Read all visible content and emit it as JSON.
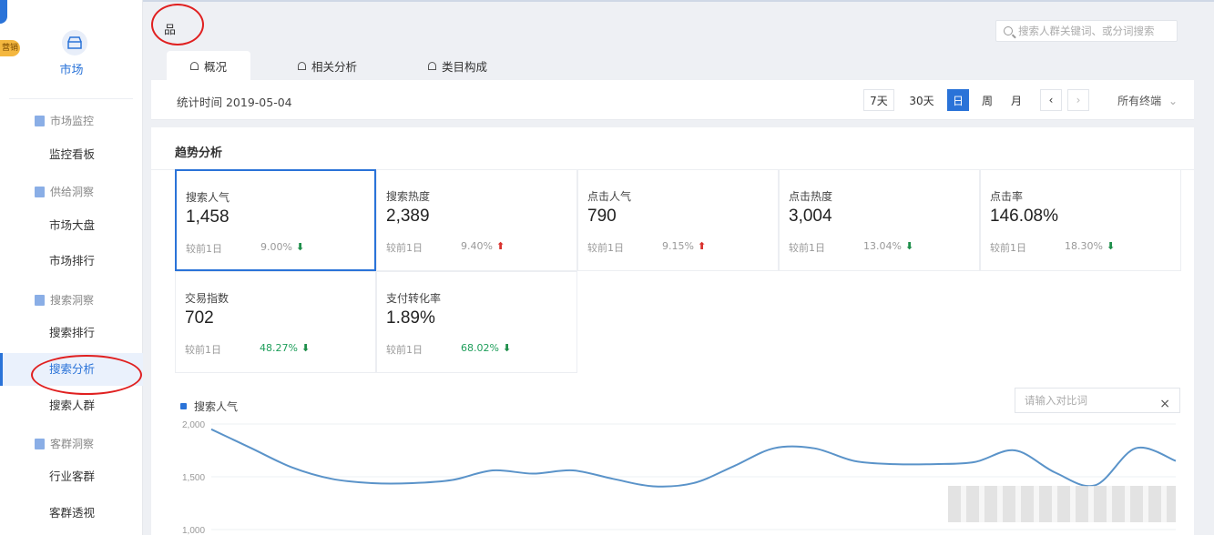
{
  "sidebar": {
    "badge": "营销",
    "market_label": "市场",
    "sections": [
      {
        "label": "市场监控",
        "items": [
          "监控看板"
        ]
      },
      {
        "label": "供给洞察",
        "items": [
          "市场大盘",
          "市场排行"
        ]
      },
      {
        "label": "搜索洞察",
        "items": [
          "搜索排行",
          "搜索分析",
          "搜索人群"
        ]
      },
      {
        "label": "客群洞察",
        "items": [
          "行业客群",
          "客群透视"
        ]
      }
    ],
    "active_item": "搜索分析"
  },
  "header": {
    "breadcrumb": "品",
    "search_placeholder": "搜索人群关键词、或分词搜索"
  },
  "tabs": [
    {
      "label": "概况",
      "active": true
    },
    {
      "label": "相关分析",
      "active": false
    },
    {
      "label": "类目构成",
      "active": false
    }
  ],
  "datebar": {
    "date_label": "统计时间 2019-05-04",
    "periods": [
      "7天",
      "30天",
      "日",
      "周",
      "月"
    ],
    "active_period": "日",
    "channel": "所有终端"
  },
  "overview": {
    "title": "趋势分析",
    "compare_label": "较前1日",
    "metrics": [
      {
        "label": "搜索人气",
        "value": "1,458",
        "pct": "9.00%",
        "dir": "down"
      },
      {
        "label": "搜索热度",
        "value": "2,389",
        "pct": "9.40%",
        "dir": "up"
      },
      {
        "label": "点击人气",
        "value": "790",
        "pct": "9.15%",
        "dir": "up"
      },
      {
        "label": "点击热度",
        "value": "3,004",
        "pct": "13.04%",
        "dir": "down"
      },
      {
        "label": "点击率",
        "value": "146.08%",
        "pct": "18.30%",
        "dir": "down"
      },
      {
        "label": "交易指数",
        "value": "702",
        "pct": "48.27%",
        "dir": "down"
      },
      {
        "label": "支付转化率",
        "value": "1.89%",
        "pct": "68.02%",
        "dir": "down"
      }
    ]
  },
  "chart": {
    "legend": "搜索人气",
    "input_placeholder": "请输入对比词",
    "close_icon": "×"
  },
  "chart_data": {
    "type": "line",
    "series": [
      {
        "name": "搜索人气",
        "values": [
          1950,
          1770,
          1590,
          1480,
          1440,
          1440,
          1470,
          1560,
          1530,
          1560,
          1480,
          1410,
          1440,
          1600,
          1770,
          1770,
          1650,
          1620,
          1620,
          1640,
          1750,
          1540,
          1420,
          1770,
          1650
        ]
      }
    ],
    "yticks": [
      "2,000",
      "1,500",
      "1,000"
    ],
    "ylim": [
      1000,
      2000
    ]
  }
}
